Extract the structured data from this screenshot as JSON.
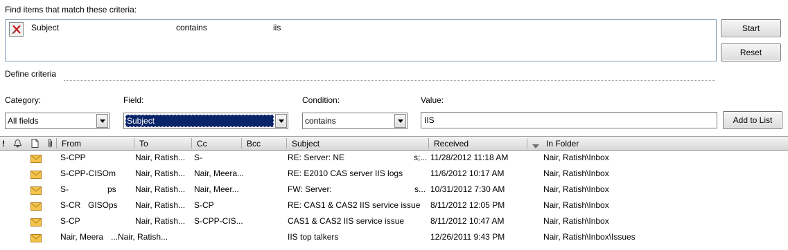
{
  "criteria": {
    "heading": "Find items that match these criteria:",
    "items": [
      {
        "field": "Subject",
        "condition": "contains",
        "value": "iis"
      }
    ]
  },
  "buttons": {
    "start": "Start",
    "reset": "Reset",
    "add_to_list": "Add to List"
  },
  "define": {
    "label": "Define criteria",
    "category_label": "Category:",
    "category_value": "All fields",
    "field_label": "Field:",
    "field_value": "Subject",
    "condition_label": "Condition:",
    "condition_value": "contains",
    "value_label": "Value:",
    "value_value": "IIS"
  },
  "results": {
    "columns": {
      "importance": "!",
      "from": "From",
      "to": "To",
      "cc": "Cc",
      "bcc": "Bcc",
      "subject": "Subject",
      "received": "Received",
      "in_folder": "In Folder"
    },
    "sort_column": "in_folder",
    "rows": [
      {
        "from": "S-CPP",
        "to": "Nair, Ratish...",
        "cc": "S-",
        "bcc": "",
        "subject": "RE: Server: NE",
        "subject_tail": "s;...",
        "received": "11/28/2012 11:18 AM",
        "folder": "Nair, Ratish\\Inbox"
      },
      {
        "from": "S-CPP-CISOm",
        "to": "Nair, Ratish...",
        "cc": "Nair, Meera...",
        "bcc": "",
        "subject": "RE: E2010 CAS server IIS logs",
        "subject_tail": "",
        "received": "11/6/2012 10:17 AM",
        "folder": "Nair, Ratish\\Inbox"
      },
      {
        "from": "S-",
        "from_tail": "ps",
        "to": "Nair, Ratish...",
        "cc": "Nair, Meer...",
        "bcc": "",
        "subject": "FW: Server:",
        "subject_tail": "s...",
        "received": "10/31/2012 7:30 AM",
        "folder": "Nair, Ratish\\Inbox"
      },
      {
        "from": "S-CR",
        "from_tail": "GISOps",
        "to": "Nair, Ratish...",
        "cc": "S-CP",
        "bcc": "",
        "subject": "RE: CAS1 & CAS2 IIS service issue",
        "subject_tail": "",
        "received": "8/11/2012 12:05 PM",
        "folder": "Nair, Ratish\\Inbox"
      },
      {
        "from": "S-CP",
        "to": "Nair, Ratish...",
        "cc": "S-CPP-CIS...",
        "bcc": "",
        "subject": "CAS1 & CAS2 IIS service issue",
        "subject_tail": "",
        "received": "8/11/2012 10:47 AM",
        "folder": "Nair, Ratish\\Inbox"
      },
      {
        "from": "Nair, Meera",
        "to": "...Nair, Ratish...",
        "cc": "",
        "bcc": "",
        "subject": "IIS top talkers",
        "subject_tail": "",
        "received": "12/26/2011 9:43 PM",
        "folder": "Nair, Ratish\\Inbox\\Issues"
      }
    ]
  },
  "icons": {
    "remove": "remove-criteria-icon",
    "envelope": "envelope-icon",
    "reminder": "reminder-icon",
    "item_type": "document-icon",
    "attachment": "attachment-icon"
  },
  "colors": {
    "selection": "#0a246a",
    "envelope": "#f4c44a"
  }
}
